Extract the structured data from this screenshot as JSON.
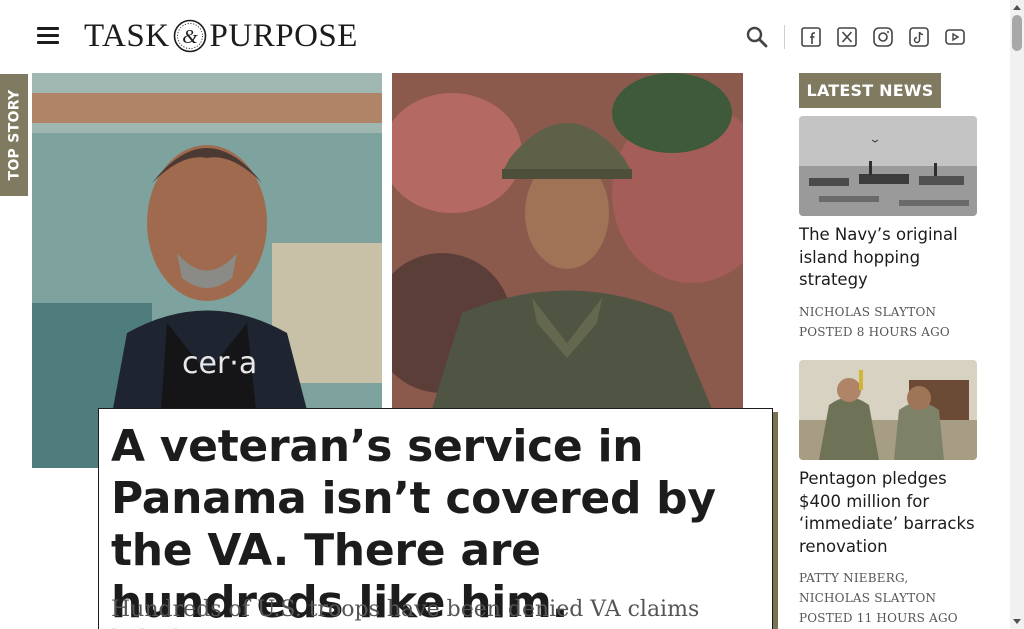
{
  "header": {
    "logo_left": "TASK",
    "logo_amp": "&",
    "logo_right": "PURPOSE",
    "icons": [
      "menu-icon",
      "search-icon",
      "facebook-icon",
      "x-icon",
      "instagram-icon",
      "tiktok-icon",
      "youtube-icon"
    ]
  },
  "top_story": {
    "tab_label": "TOP STORY",
    "photo_badge_text": "cer·a",
    "headline": "A veteran’s service in Panama isn’t covered by the VA. There are hundreds like him.",
    "dek": "Hundreds of U.S. troops have been denied VA claims linked to toxic exposure in Panama"
  },
  "sidebar": {
    "label": "LATEST NEWS",
    "items": [
      {
        "title": "The Navy’s original island hopping strategy",
        "author": "NICHOLAS SLAYTON",
        "posted": "POSTED 8 HOURS AGO"
      },
      {
        "title": "Pentagon pledges $400 million for ‘immediate’ barracks renovation",
        "author": "PATTY NIEBERG, NICHOLAS SLAYTON",
        "posted": "POSTED 11 HOURS AGO"
      }
    ]
  },
  "colors": {
    "accent": "#7f7a60",
    "text": "#1c1c1c",
    "muted": "#555555"
  }
}
